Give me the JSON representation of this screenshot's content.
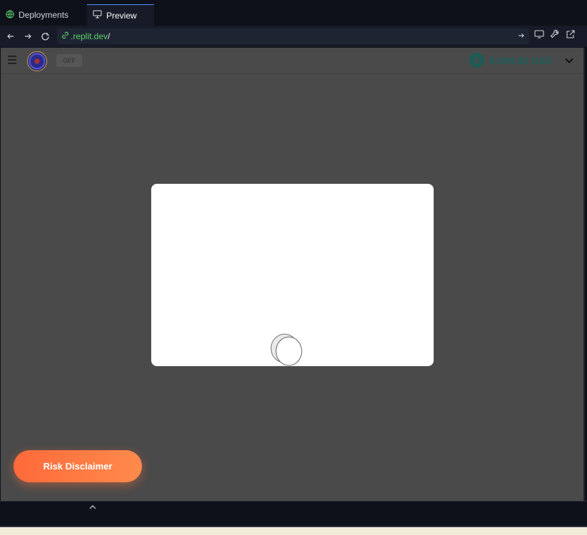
{
  "tabs": [
    {
      "label": "Deployments",
      "icon": "globe-icon",
      "active": false
    },
    {
      "label": "Preview",
      "icon": "monitor-icon",
      "active": true
    }
  ],
  "browser": {
    "url_host": ".replit.dev",
    "url_path": "/"
  },
  "app": {
    "toggle_label": "OFF",
    "balance": "9,948.92 USD",
    "coin_symbol": "Đ",
    "risk_button_label": "Risk Disclaimer"
  },
  "colors": {
    "accent_tab": "#4f8cf7",
    "url_host": "#5bd36b",
    "risk_button": "#ff7a42",
    "balance": "#1d5f5b",
    "viewport_bg": "#4a4a4a"
  }
}
